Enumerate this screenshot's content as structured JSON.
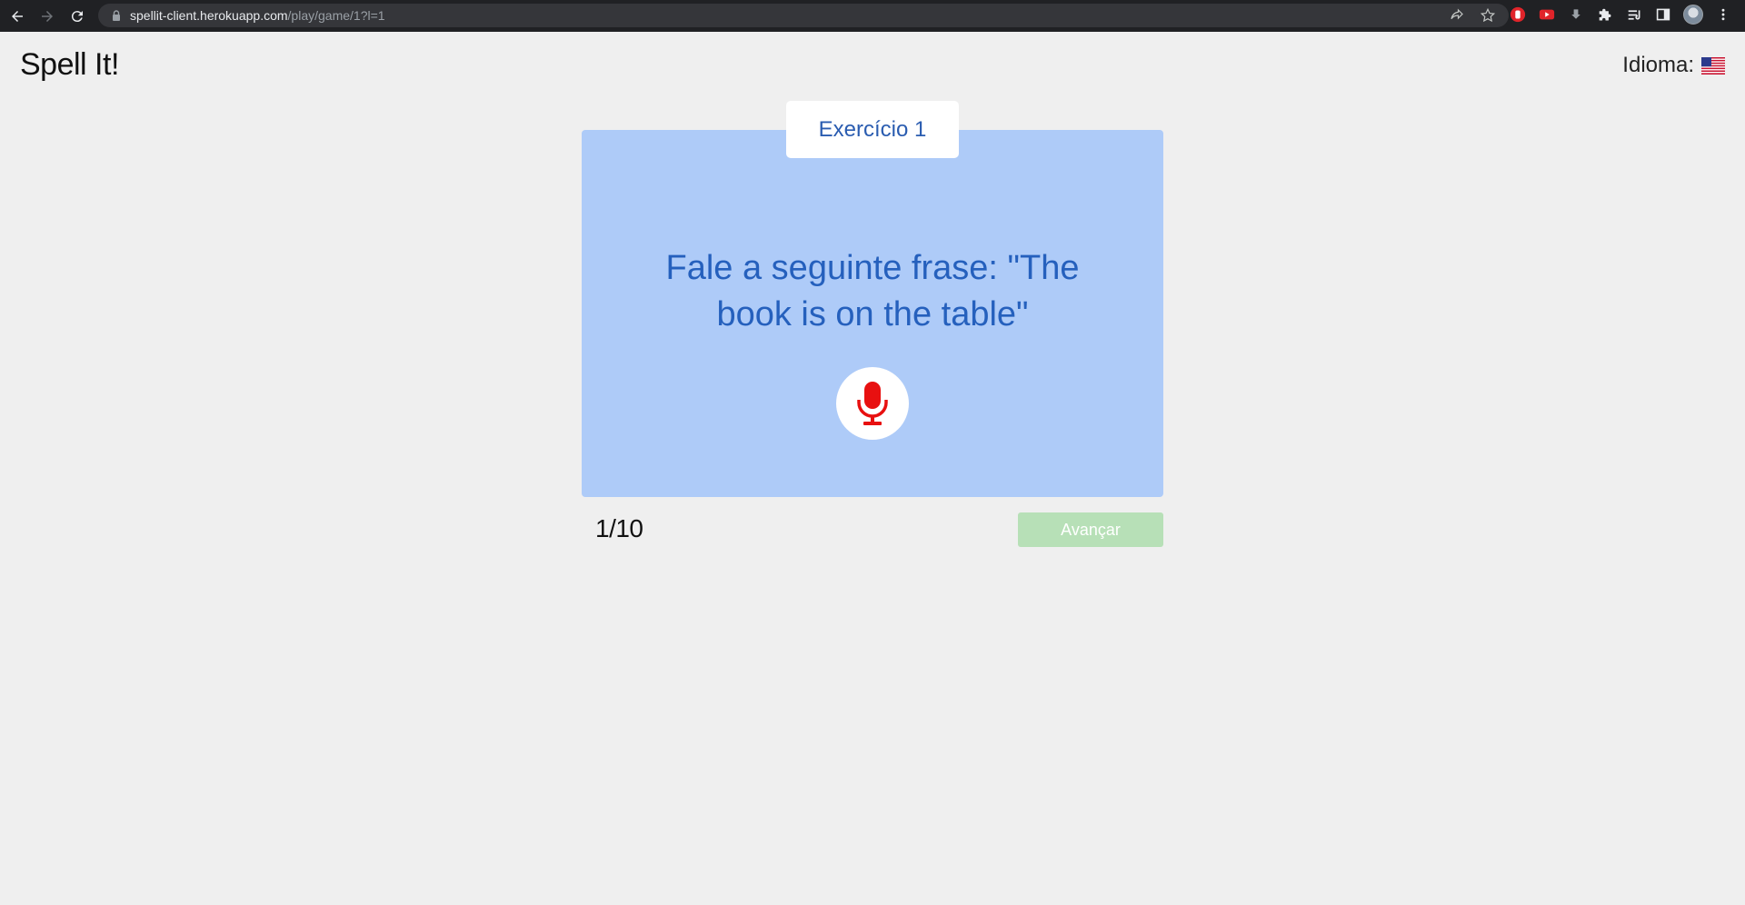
{
  "browser": {
    "url_host": "spellit-client.herokuapp.com",
    "url_path": "/play/game/1?l=1"
  },
  "header": {
    "title": "Spell It!",
    "language_label": "Idioma:",
    "language_flag": "us-flag-icon"
  },
  "exercise": {
    "tab_label": "Exercício 1",
    "prompt": "Fale a seguinte frase: \"The book is on the table\"",
    "mic_icon": "microphone-icon"
  },
  "footer": {
    "progress": "1/10",
    "next_label": "Avançar"
  },
  "colors": {
    "page_bg": "#efefef",
    "card_bg": "#aecbf8",
    "prompt_text": "#2560bd",
    "mic": "#e81010",
    "next_button_bg": "#b7e0b7"
  }
}
